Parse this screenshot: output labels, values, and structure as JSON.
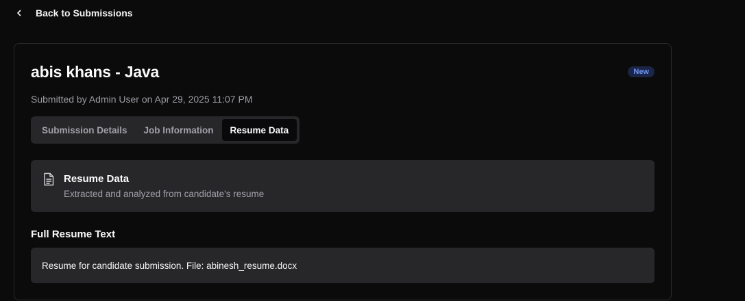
{
  "nav": {
    "back_label": "Back to Submissions",
    "back_icon": "chevron-left-icon"
  },
  "submission": {
    "title": "abis khans - Java",
    "status_badge": "New",
    "submitted_by_line": "Submitted by Admin User on Apr 29, 2025 11:07 PM"
  },
  "tabs": [
    {
      "label": "Submission Details",
      "active": false
    },
    {
      "label": "Job Information",
      "active": false
    },
    {
      "label": "Resume Data",
      "active": true
    }
  ],
  "resume_panel": {
    "icon": "document-icon",
    "title": "Resume Data",
    "description": "Extracted and analyzed from candidate's resume"
  },
  "full_resume": {
    "heading": "Full Resume Text",
    "text": "Resume for candidate submission. File: abinesh_resume.docx"
  },
  "colors": {
    "background": "#0b0b0c",
    "card_border": "#2a2a2e",
    "panel": "#27272a",
    "badge_bg": "#1b2547",
    "badge_text": "#6e95f5"
  }
}
